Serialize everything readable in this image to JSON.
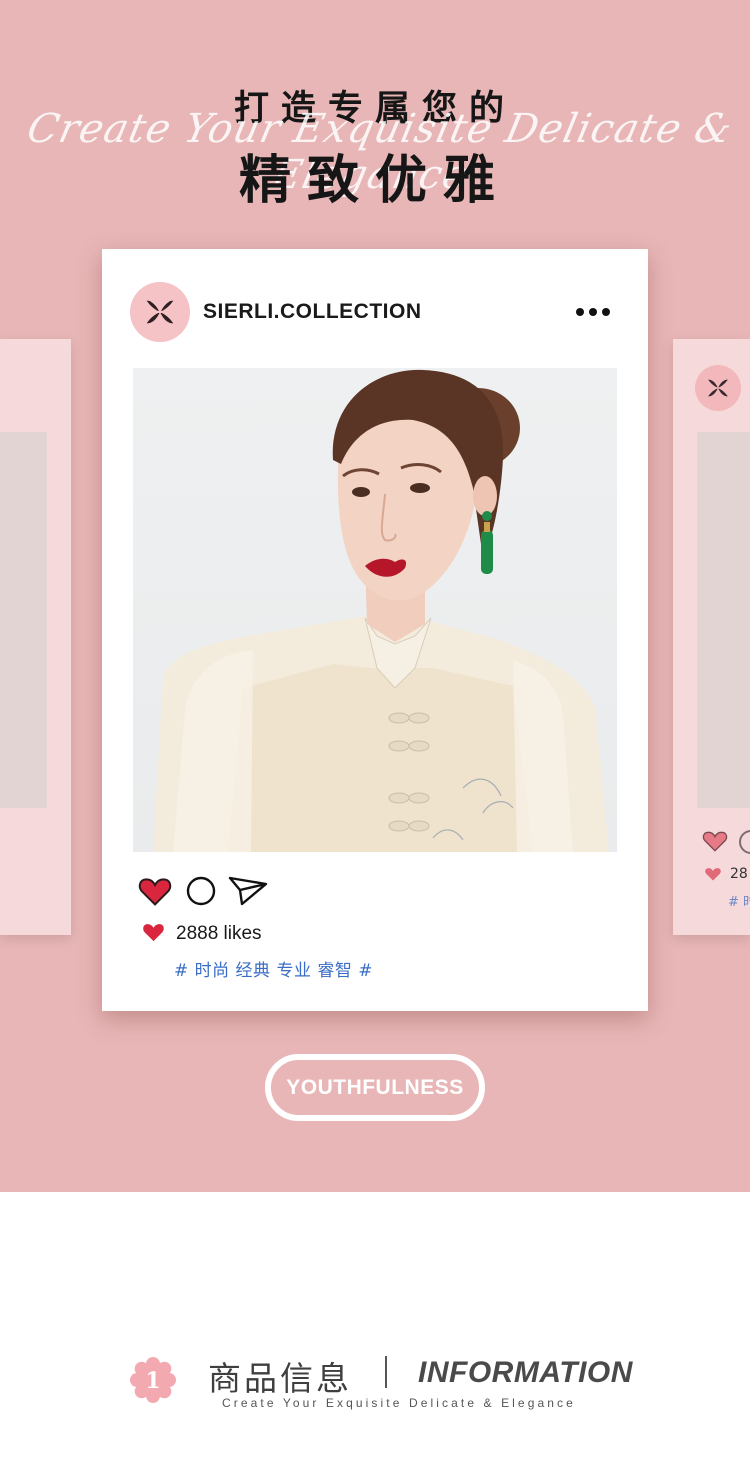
{
  "hero": {
    "headline_top": "打造专属您的",
    "script_line": "Create Your Exquisite Delicate & Elegance",
    "headline_main": "精致优雅"
  },
  "post": {
    "username": "SIERLI.COLLECTION",
    "likes": "2888 likes",
    "tags": "# 时尚 经典 专业 睿智 #"
  },
  "side_post": {
    "likes": "28",
    "tags": "# 时"
  },
  "button": {
    "label": "YOUTHFULNESS"
  },
  "info": {
    "badge_number": "1",
    "title_cn": "商品信息",
    "title_en": "INFORMATION",
    "subtitle": "Create Your Exquisite Delicate & Elegance"
  },
  "colors": {
    "background_pink": "#e8b6b6",
    "heart_red": "#d9263e",
    "tag_blue": "#3a6ec6"
  },
  "icons": [
    "brand-logo-icon",
    "more-icon",
    "heart-icon",
    "comment-icon",
    "share-icon"
  ]
}
